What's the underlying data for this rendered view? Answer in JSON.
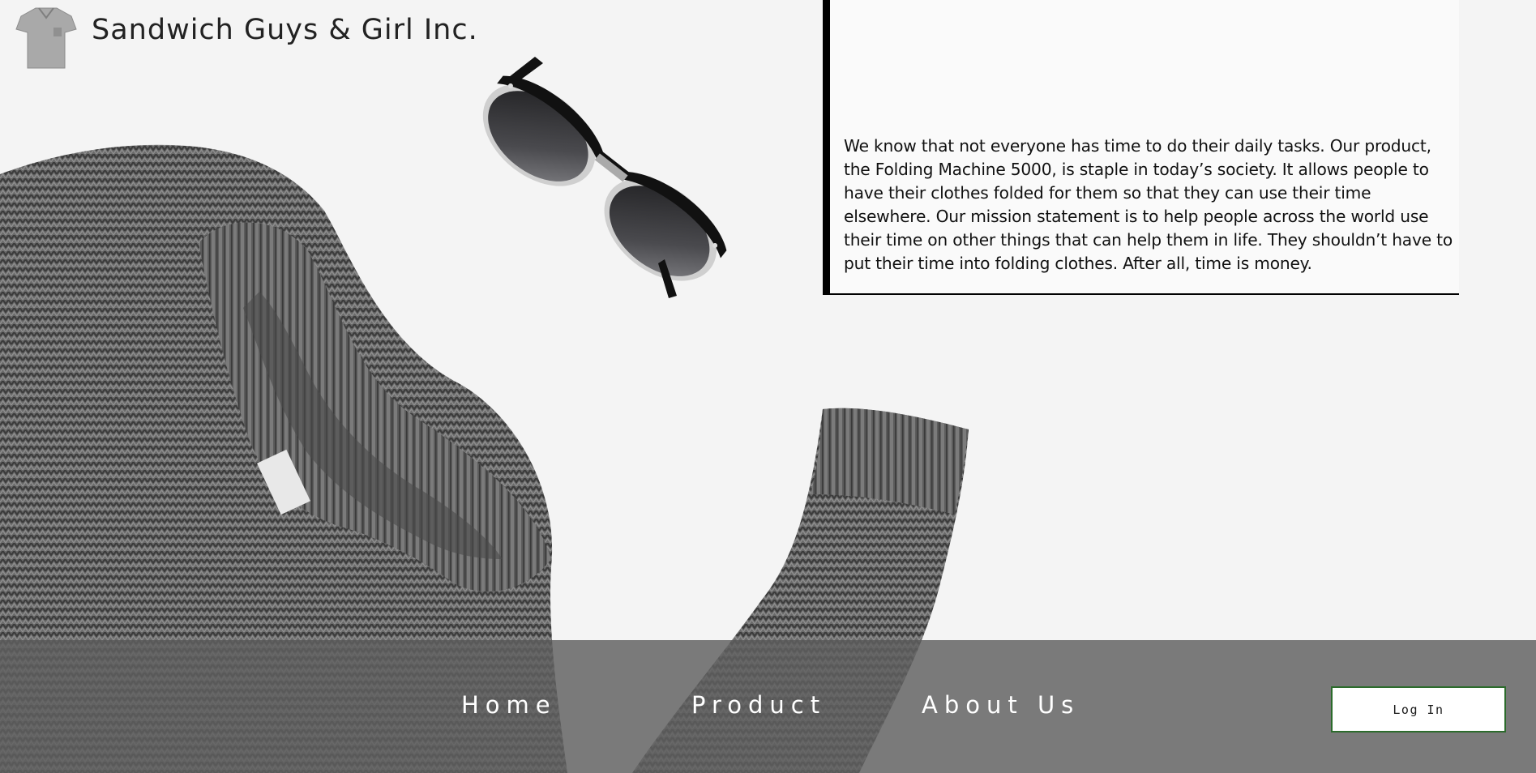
{
  "brand": {
    "title": "Sandwich Guys & Girl Inc.",
    "logo_icon": "shirt-icon"
  },
  "mission": {
    "text": "We know that not everyone has time to do their daily tasks. Our product, the Folding Machine 5000, is staple in today’s society. It allows people to have their clothes folded for them so that they can use their time elsewhere. Our mission statement is to help people across the world use their time on other things that can help them in life. They shouldn’t have to put their time into folding clothes. After all, time is money."
  },
  "nav": {
    "items": [
      {
        "label": "Home"
      },
      {
        "label": "Product"
      },
      {
        "label": "About Us"
      }
    ],
    "login_label": "Log In"
  },
  "colors": {
    "navbar_bg": "#5f5f5f",
    "login_border": "#2c6b2c",
    "accent_border": "#000000"
  }
}
